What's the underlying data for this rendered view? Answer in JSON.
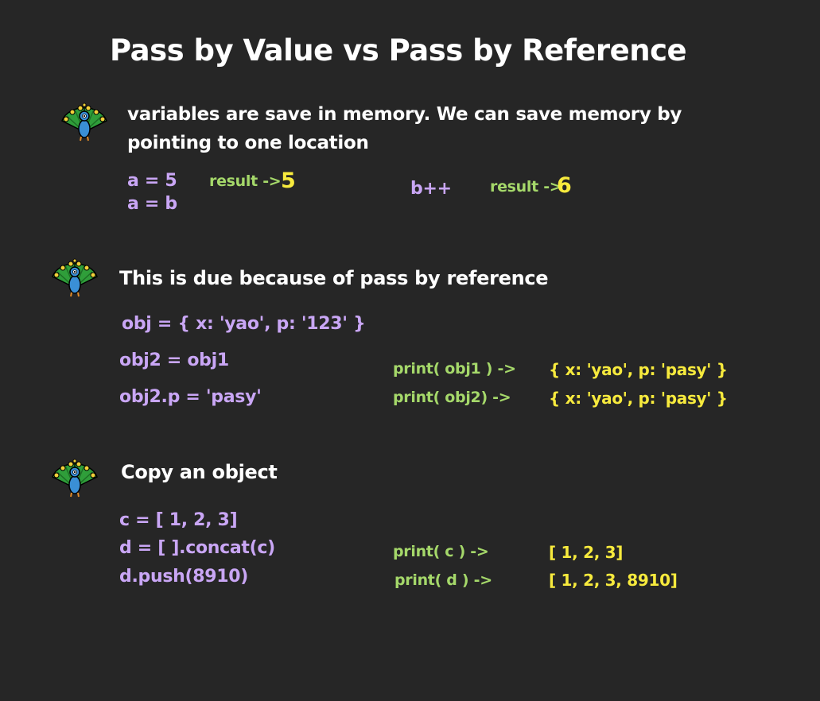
{
  "title": "Pass by Value vs Pass by Reference",
  "section1": {
    "intro_line1": "variables are save in memory. We can save memory by",
    "intro_line2": "pointing to one location",
    "code_line1": "a = 5",
    "code_line2": "a = b",
    "result_label_1": "result ->",
    "result_value_1": "5",
    "code_incr": "b++",
    "result_label_2": "result ->",
    "result_value_2": "6"
  },
  "section2": {
    "heading": "This is due because of pass by reference",
    "code_line1": "obj  = { x: 'yao', p: '123' }",
    "code_line2": "obj2 = obj1",
    "code_line3": "obj2.p = 'pasy'",
    "print1": "print(  obj1 ) ->",
    "print1_result": "{ x: 'yao', p: 'pasy' }",
    "print2": "print(  obj2) ->",
    "print2_result": "{ x: 'yao', p: 'pasy' }"
  },
  "section3": {
    "heading": "Copy an object",
    "code_line1": "c = [ 1, 2, 3]",
    "code_line2": "d = [ ].concat(c)",
    "code_line3": "d.push(8910)",
    "print1": "print( c ) ->",
    "print1_result": "[ 1, 2, 3]",
    "print2": "print( d ) ->",
    "print2_result": "[ 1, 2, 3, 8910]"
  },
  "icons": [
    "peacock-icon",
    "peacock-icon",
    "peacock-icon"
  ],
  "colors": {
    "background": "#262626",
    "text": "#ffffff",
    "code": "#c9a6f5",
    "print": "#a5d86a",
    "result": "#f7ea3d"
  }
}
